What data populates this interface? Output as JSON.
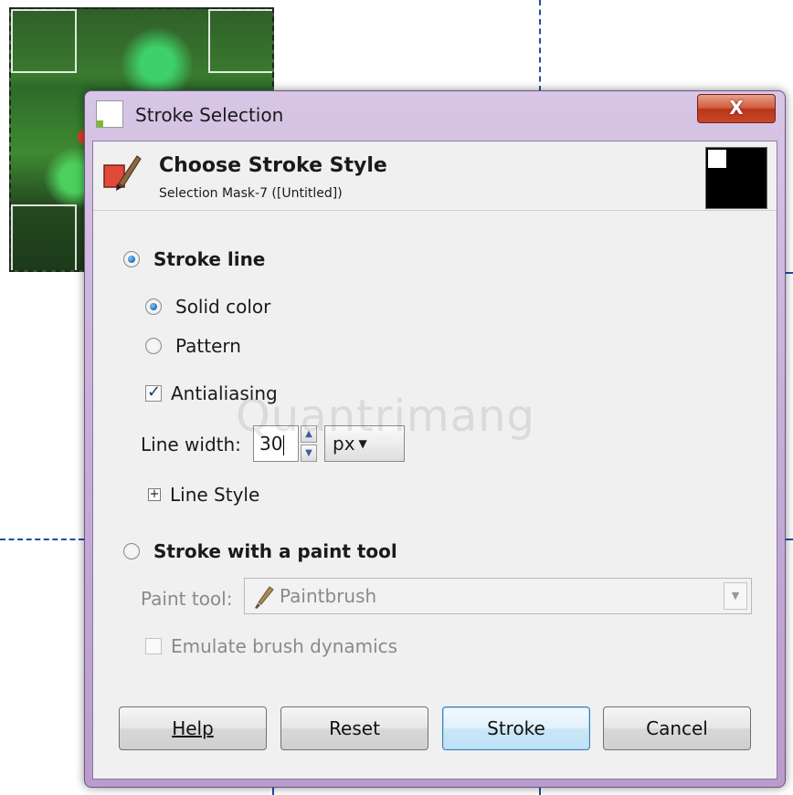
{
  "dialog": {
    "title": "Stroke Selection",
    "close_label": "X",
    "header_title": "Choose Stroke Style",
    "header_subtitle": "Selection Mask-7 ([Untitled])"
  },
  "stroke_line": {
    "label": "Stroke line",
    "selected": true,
    "solid_color_label": "Solid color",
    "solid_color_selected": true,
    "pattern_label": "Pattern",
    "pattern_selected": false,
    "antialiasing_label": "Antialiasing",
    "antialiasing_checked": true,
    "line_width_label": "Line width:",
    "line_width_value": "30",
    "unit_value": "px",
    "line_style_label": "Line Style"
  },
  "paint_tool_section": {
    "label": "Stroke with a paint tool",
    "selected": false,
    "paint_tool_label": "Paint tool:",
    "paint_tool_value": "Paintbrush",
    "emulate_label": "Emulate brush dynamics",
    "emulate_checked": false
  },
  "buttons": {
    "help": "Help",
    "reset": "Reset",
    "stroke": "Stroke",
    "cancel": "Cancel"
  },
  "watermark": "Quantrimang",
  "colors": {
    "window_frame": "#c7add8",
    "close_button": "#c8482c",
    "default_button": "#3c7fb1",
    "radio_selected": "#1c6fb8"
  },
  "icons": [
    "app-icon",
    "stroke-style-icon",
    "paintbrush-icon",
    "spin-up-icon",
    "spin-down-icon",
    "dropdown-arrow-icon",
    "expander-plus-icon"
  ]
}
